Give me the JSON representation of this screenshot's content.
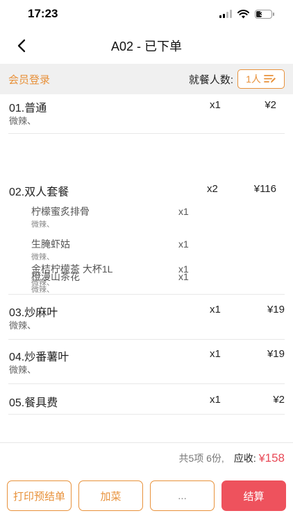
{
  "status": {
    "time": "17:23",
    "battery": "34"
  },
  "header": {
    "title": "A02 - 已下单"
  },
  "member_bar": {
    "login_label": "会员登录",
    "diners_label": "就餐人数:",
    "diners_value": "1人"
  },
  "items": [
    {
      "name": "01.普通",
      "note": "微辣、",
      "qty": "x1",
      "price": "¥2"
    },
    {
      "name": "02.双人套餐",
      "qty": "x2",
      "price": "¥116",
      "subitems": [
        {
          "name": "柠檬蜜炙排骨",
          "note": "微辣、",
          "qty": "x1"
        },
        {
          "name": "生腌虾姑",
          "note": "微辣、",
          "qty": "x1"
        },
        {
          "name": "橙漫山茶花",
          "note": "微辣、",
          "qty": "x1"
        },
        {
          "name": "金桔柠檬茶 大杯1L",
          "note": "微辣、",
          "qty": "x1"
        }
      ]
    },
    {
      "name": "03.炒麻叶",
      "note": "微辣、",
      "qty": "x1",
      "price": "¥19"
    },
    {
      "name": "04.炒番薯叶",
      "note": "微辣、",
      "qty": "x1",
      "price": "¥19"
    },
    {
      "name": "05.餐具费",
      "qty": "x1",
      "price": "¥2"
    }
  ],
  "summary": {
    "count_text": "共5项 6份,",
    "due_label": "应收:",
    "currency": "¥",
    "due_amount": "158"
  },
  "actions": {
    "print_label": "打印预结单",
    "add_label": "加菜",
    "more_label": "...",
    "checkout_label": "结算"
  },
  "colors": {
    "accent": "#e8913a",
    "danger": "#ee525d",
    "price_red": "#e84a57"
  }
}
